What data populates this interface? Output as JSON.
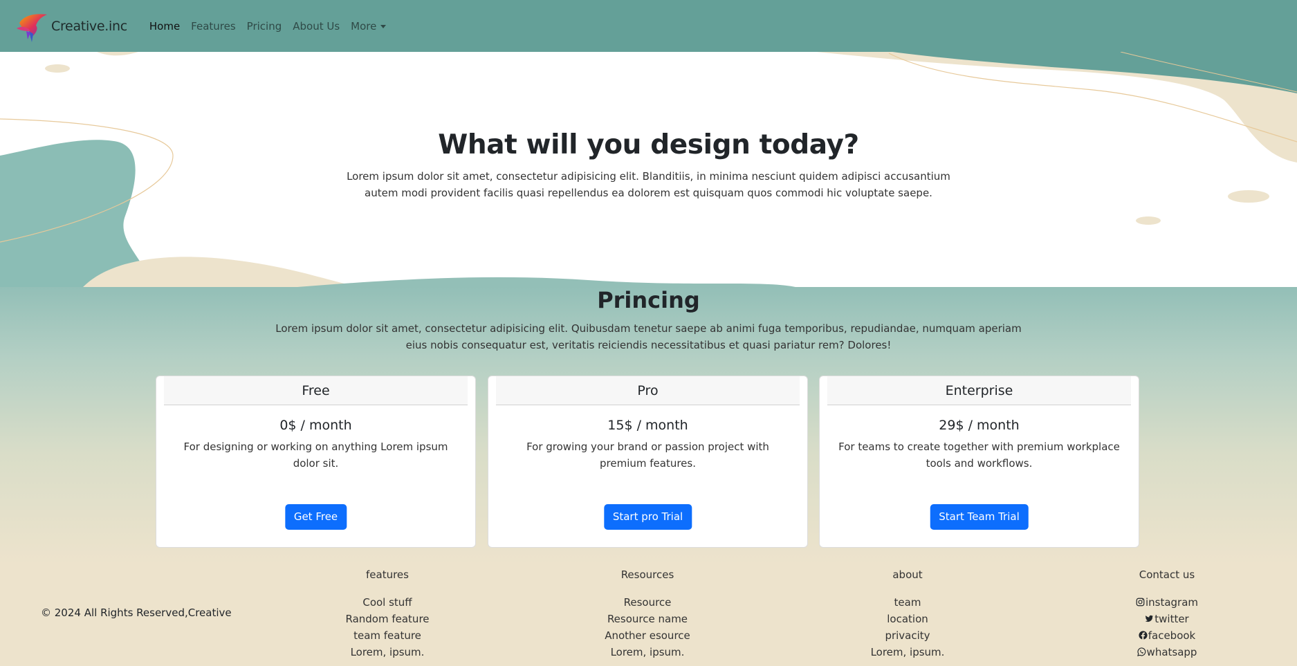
{
  "nav": {
    "brand": "Creative.inc",
    "links": [
      "Home",
      "Features",
      "Pricing",
      "About Us",
      "More"
    ]
  },
  "hero": {
    "title": "What will you design today?",
    "text": "Lorem ipsum dolor sit amet, consectetur adipisicing elit. Blanditiis, in minima nesciunt quidem adipisci accusantium autem modi provident facilis quasi repellendus ea dolorem est quisquam quos commodi hic voluptate saepe."
  },
  "pricing": {
    "title": "Princing",
    "text": "Lorem ipsum dolor sit amet, consectetur adipisicing elit. Quibusdam tenetur saepe ab animi fuga temporibus, repudiandae, numquam aperiam eius nobis consequatur est, veritatis reiciendis necessitatibus et quasi pariatur rem? Dolores!",
    "plans": [
      {
        "name": "Free",
        "price": "0$ / month",
        "desc": "For designing or working on anything Lorem ipsum dolor sit.",
        "button": "Get Free"
      },
      {
        "name": "Pro",
        "price": "15$ / month",
        "desc": "For growing your brand or passion project with premium features.",
        "button": "Start pro Trial"
      },
      {
        "name": "Enterprise",
        "price": "29$ / month",
        "desc": "For teams to create together with premium workplace tools and workflows.",
        "button": "Start Team Trial"
      }
    ]
  },
  "footer": {
    "copyright": "© 2024 All Rights Reserved,Creative",
    "columns": [
      {
        "title": "features",
        "items": [
          "Cool stuff",
          "Random feature",
          "team feature",
          "Lorem, ipsum."
        ]
      },
      {
        "title": "Resources",
        "items": [
          "Resource",
          "Resource name",
          "Another esource",
          "Lorem, ipsum."
        ]
      },
      {
        "title": "about",
        "items": [
          "team",
          "location",
          "privacity",
          "Lorem, ipsum."
        ]
      },
      {
        "title": "Contact us",
        "items": [
          "instagram",
          "twitter",
          "facebook",
          "whatsapp"
        ]
      }
    ]
  },
  "colors": {
    "navbar": "#64a098",
    "primary_button": "#0d6efd",
    "teal_wave": "#8bbdb5",
    "cream_wave": "#ede3cc"
  },
  "icons": [
    "bird-logo",
    "instagram-icon",
    "twitter-icon",
    "facebook-icon",
    "whatsapp-icon"
  ]
}
